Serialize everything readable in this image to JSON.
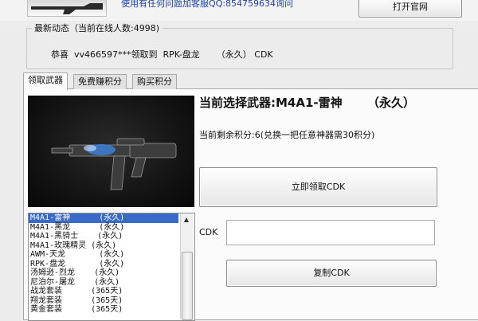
{
  "header": {
    "qq_text": "使用有任何问题加客服QQ:854759634询问",
    "open_site_label": "打开官网"
  },
  "news": {
    "title": "最新动态（当前在线人数:4998)",
    "message": "恭喜  vv466597***领取到  RPK-盘龙      （永久） CDK"
  },
  "tabs": [
    {
      "label": "领取武器",
      "active": true
    },
    {
      "label": "免费赚积分",
      "active": false
    },
    {
      "label": "购买积分",
      "active": false
    }
  ],
  "weapon": {
    "current_title": "当前选择武器:M4A1-雷神      （永久）",
    "points_text": "当前剩余积分:6(兑换一把任意神器需30积分)"
  },
  "weapon_list": [
    {
      "label": "M4A1-雷神      (永久)",
      "selected": true
    },
    {
      "label": "M4A1-黑龙      (永久)",
      "selected": false
    },
    {
      "label": "M4A1-黑骑士    (永久)",
      "selected": false
    },
    {
      "label": "M4A1-玫瑰精灵 (永久)",
      "selected": false
    },
    {
      "label": "AWM-天龙       (永久)",
      "selected": false
    },
    {
      "label": "RPK-盘龙       (永久)",
      "selected": false
    },
    {
      "label": "汤姆逊-烈龙    (永久)",
      "selected": false
    },
    {
      "label": "尼泊尔-屠龙    (永久)",
      "selected": false
    },
    {
      "label": "战龙套装      (365天)",
      "selected": false
    },
    {
      "label": "翔龙套装      (365天)",
      "selected": false
    },
    {
      "label": "黄金套装      (365天)",
      "selected": false
    }
  ],
  "actions": {
    "claim_label": "立即领取CDK",
    "cdk_label": "CDK",
    "cdk_value": "",
    "copy_label": "复制CDK"
  },
  "colors": {
    "selection": "#3a6ac8",
    "link_text": "#1e3fa8"
  }
}
